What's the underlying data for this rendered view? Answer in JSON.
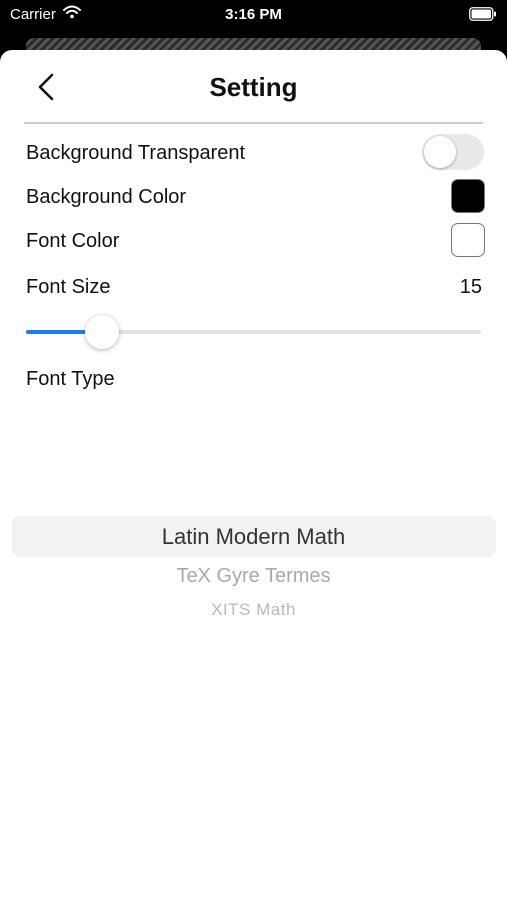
{
  "status_bar": {
    "carrier": "Carrier",
    "time": "3:16 PM"
  },
  "header": {
    "title": "Setting"
  },
  "settings": {
    "background_transparent": {
      "label": "Background Transparent",
      "on": false
    },
    "background_color": {
      "label": "Background Color",
      "color": "#000000"
    },
    "font_color": {
      "label": "Font Color",
      "color": "#ffffff"
    },
    "font_size": {
      "label": "Font Size",
      "value": "15",
      "slider_fraction": 0.168
    },
    "font_type": {
      "label": "Font Type",
      "options": [
        "Latin Modern Math",
        "TeX Gyre Termes",
        "XITS Math"
      ],
      "selected": "Latin Modern Math"
    }
  },
  "colors": {
    "accent": "#1e7cf2"
  }
}
